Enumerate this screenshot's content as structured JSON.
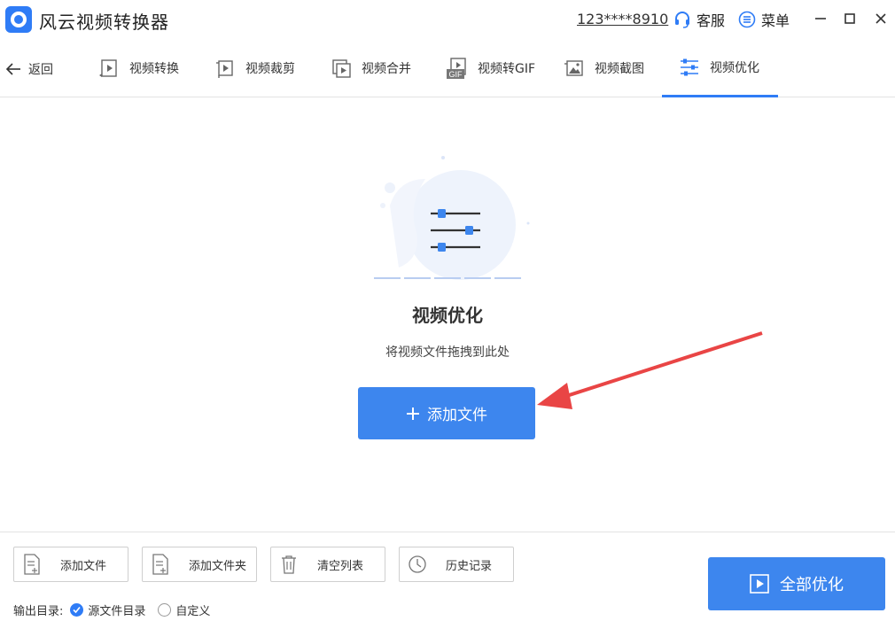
{
  "app": {
    "title": "风云视频转换器",
    "account": "123****8910",
    "service_label": "客服",
    "menu_label": "菜单"
  },
  "nav": {
    "back_label": "返回",
    "tabs": [
      {
        "label": "视频转换",
        "icon": "video-convert-icon"
      },
      {
        "label": "视频裁剪",
        "icon": "video-crop-icon"
      },
      {
        "label": "视频合并",
        "icon": "video-merge-icon"
      },
      {
        "label": "视频转GIF",
        "icon": "gif-icon",
        "icon_text": "GIF"
      },
      {
        "label": "视频截图",
        "icon": "screenshot-icon"
      },
      {
        "label": "视频优化",
        "icon": "sliders-icon",
        "active": true
      }
    ]
  },
  "main": {
    "title": "视频优化",
    "subtitle": "将视频文件拖拽到此处",
    "add_file_button": "添加文件"
  },
  "toolbar": {
    "add_file": "添加文件",
    "add_folder": "添加文件夹",
    "clear_list": "清空列表",
    "history": "历史记录"
  },
  "output": {
    "label": "输出目录:",
    "options": [
      {
        "label": "源文件目录",
        "checked": true
      },
      {
        "label": "自定义",
        "checked": false
      }
    ]
  },
  "optimize_all_label": "全部优化",
  "colors": {
    "accent": "#3d86ee",
    "tab_underline": "#2f7cf6",
    "arrow": "#e94545"
  }
}
